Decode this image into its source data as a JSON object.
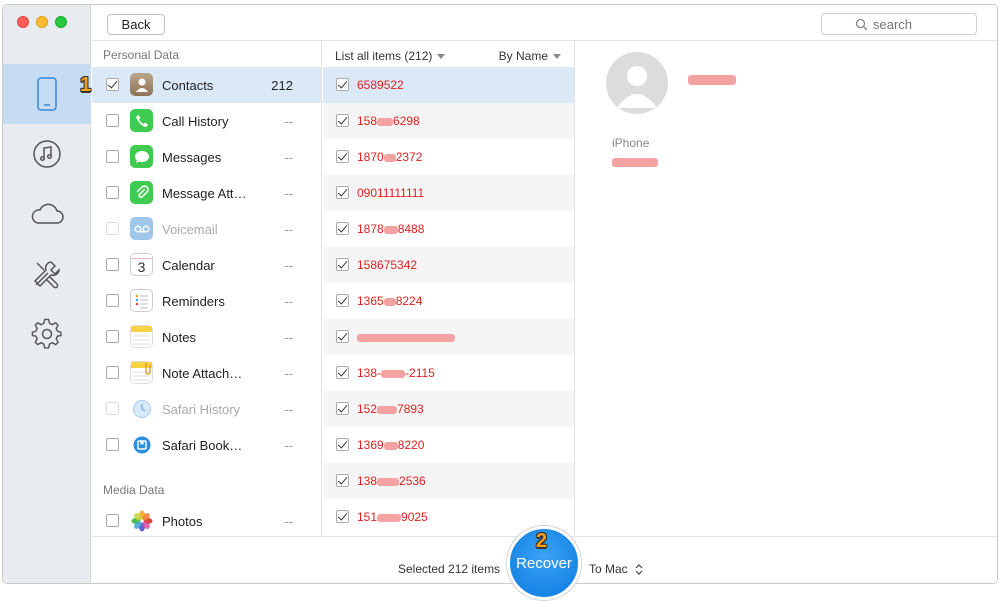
{
  "window": {
    "back_label": "Back",
    "search_placeholder": "search"
  },
  "rail": {
    "items": [
      {
        "icon": "device-icon",
        "active": true
      },
      {
        "icon": "music-icon"
      },
      {
        "icon": "cloud-icon"
      },
      {
        "icon": "tools-icon"
      },
      {
        "icon": "gear-icon"
      }
    ]
  },
  "categories": {
    "personal_title": "Personal Data",
    "media_title": "Media Data",
    "items": [
      {
        "label": "Contacts",
        "count": "212",
        "checked": true,
        "active": true,
        "icon": "contacts-icon"
      },
      {
        "label": "Call History",
        "count": "--",
        "icon": "phone-icon"
      },
      {
        "label": "Messages",
        "count": "--",
        "icon": "messages-icon"
      },
      {
        "label": "Message Att…",
        "count": "--",
        "icon": "paperclip-icon"
      },
      {
        "label": "Voicemail",
        "count": "--",
        "disabled": true,
        "icon": "voicemail-icon"
      },
      {
        "label": "Calendar",
        "count": "--",
        "icon": "calendar-icon",
        "calendar_day": "3"
      },
      {
        "label": "Reminders",
        "count": "--",
        "icon": "reminders-icon"
      },
      {
        "label": "Notes",
        "count": "--",
        "icon": "notes-icon"
      },
      {
        "label": "Note Attach…",
        "count": "--",
        "icon": "note-attach-icon"
      },
      {
        "label": "Safari History",
        "count": "--",
        "disabled": true,
        "icon": "safari-history-icon"
      },
      {
        "label": "Safari Book…",
        "count": "--",
        "icon": "safari-bookmark-icon"
      }
    ],
    "media_items": [
      {
        "label": "Photos",
        "count": "--",
        "icon": "photos-icon"
      }
    ]
  },
  "list": {
    "all_label": "List all items (212)",
    "sort_label": "By Name",
    "items": [
      {
        "pre": "6589522",
        "post": ""
      },
      {
        "pre": "158",
        "post": "6298"
      },
      {
        "pre": "1870",
        "post": "2372"
      },
      {
        "pre": "09011111111",
        "post": ""
      },
      {
        "pre": "1878",
        "post": "8488"
      },
      {
        "pre": "158675342",
        "post": ""
      },
      {
        "pre": "1365",
        "post": "8224"
      },
      {
        "pre": "",
        "post": ""
      },
      {
        "pre": "138-",
        "post": "-2115"
      },
      {
        "pre": "152",
        "post": "7893"
      },
      {
        "pre": "1369",
        "post": "8220"
      },
      {
        "pre": "138",
        "post": "2536"
      },
      {
        "pre": "151",
        "post": "9025"
      }
    ]
  },
  "detail": {
    "device_label": "iPhone"
  },
  "footer": {
    "selected_text": "Selected 212 items",
    "recover_label": "Recover",
    "destination": "To Mac"
  },
  "badges": {
    "step1": "1",
    "step2": "2"
  },
  "colors": {
    "accent": "#1a86e6",
    "selection": "#dbe9f7",
    "item_text": "#e02020",
    "badge": "#f2a01c"
  }
}
